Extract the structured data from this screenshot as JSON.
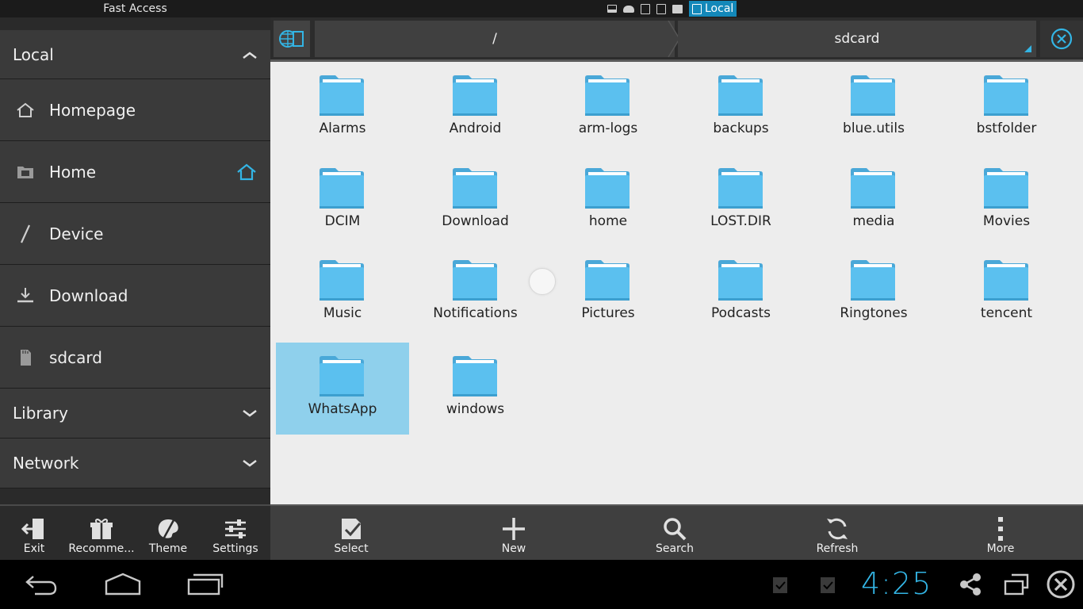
{
  "top_bar": {
    "fast_access_title": "Fast Access",
    "active_window_label": "Local"
  },
  "sidebar": {
    "local_header": "Local",
    "items": [
      {
        "label": "Homepage",
        "icon": "house-outline-icon"
      },
      {
        "label": "Home",
        "icon": "folder-icon"
      },
      {
        "label": "Device",
        "icon": "slash-icon"
      },
      {
        "label": "Download",
        "icon": "download-icon"
      },
      {
        "label": "sdcard",
        "icon": "sdcard-icon"
      }
    ],
    "library_header": "Library",
    "network_header": "Network"
  },
  "sidebar_toolbar": {
    "exit": "Exit",
    "recommend": "Recomme...",
    "theme": "Theme",
    "settings": "Settings"
  },
  "path_bar": {
    "root": "/",
    "current": "sdcard"
  },
  "files": [
    {
      "name": "Alarms"
    },
    {
      "name": "Android"
    },
    {
      "name": "arm-logs"
    },
    {
      "name": "backups"
    },
    {
      "name": "blue.utils"
    },
    {
      "name": "bstfolder"
    },
    {
      "name": "DCIM"
    },
    {
      "name": "Download"
    },
    {
      "name": "home"
    },
    {
      "name": "LOST.DIR"
    },
    {
      "name": "media"
    },
    {
      "name": "Movies"
    },
    {
      "name": "Music"
    },
    {
      "name": "Notifications"
    },
    {
      "name": "Pictures"
    },
    {
      "name": "Podcasts"
    },
    {
      "name": "Ringtones"
    },
    {
      "name": "tencent"
    },
    {
      "name": "WhatsApp",
      "selected": true
    },
    {
      "name": "windows"
    }
  ],
  "main_toolbar": {
    "select": "Select",
    "new": "New",
    "search": "Search",
    "refresh": "Refresh",
    "more": "More"
  },
  "system": {
    "clock": "4:25"
  },
  "colors": {
    "accent": "#33b5e5",
    "folder": "#5bc0ef",
    "selection": "#8fd0ec",
    "file_area_bg": "#ededed"
  }
}
